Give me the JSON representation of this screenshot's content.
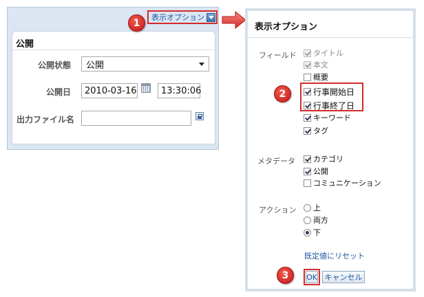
{
  "left_panel": {
    "display_options_label": "表示オプション",
    "title": "公開",
    "fields": {
      "status_label": "公開状態",
      "status_value": "公開",
      "date_label": "公開日",
      "date_value": "2010-03-16",
      "time_value": "13:30:06",
      "filename_label": "出力ファイル名",
      "filename_value": ""
    }
  },
  "callouts": [
    "1",
    "2",
    "3"
  ],
  "dialog": {
    "title": "表示オプション",
    "field_group": {
      "label": "フィールド",
      "items": [
        {
          "label": "タイトル",
          "checked": true,
          "disabled": true
        },
        {
          "label": "本文",
          "checked": true,
          "disabled": true
        },
        {
          "label": "概要",
          "checked": false,
          "disabled": false
        },
        {
          "label": "行事開始日",
          "checked": true,
          "disabled": false
        },
        {
          "label": "行事終了日",
          "checked": true,
          "disabled": false
        },
        {
          "label": "キーワード",
          "checked": true,
          "disabled": false
        },
        {
          "label": "タグ",
          "checked": true,
          "disabled": false
        }
      ]
    },
    "metadata_group": {
      "label": "メタデータ",
      "items": [
        {
          "label": "カテゴリ",
          "checked": true
        },
        {
          "label": "公開",
          "checked": true
        },
        {
          "label": "コミュニケーション",
          "checked": false
        }
      ]
    },
    "action_group": {
      "label": "アクション",
      "items": [
        {
          "label": "上",
          "selected": false
        },
        {
          "label": "両方",
          "selected": false
        },
        {
          "label": "下",
          "selected": true
        }
      ]
    },
    "reset_label": "既定値にリセット",
    "ok_label": "OK",
    "cancel_label": "キャンセル"
  },
  "colors": {
    "accent_red": "#d42a2a",
    "link_blue": "#1f57a3",
    "panel_bg": "#dbe6f2"
  }
}
